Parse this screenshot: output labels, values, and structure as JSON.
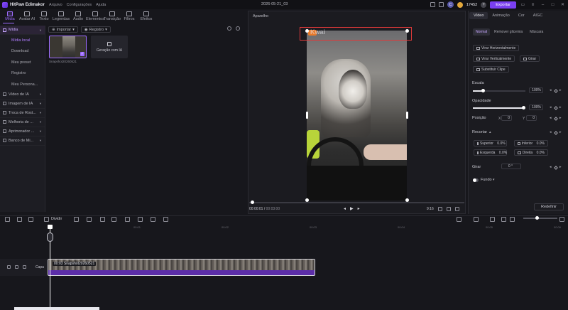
{
  "app": {
    "name": "HitPaw Edimakor",
    "menu": [
      "Arquivo",
      "Configurações",
      "Ajuda"
    ],
    "document_title": "2026-05-21_03",
    "credits": "17452",
    "avatar_letter": "C",
    "export_label": "Exportar"
  },
  "toolbar": [
    {
      "label": "Mídia",
      "active": true
    },
    {
      "label": "Avatar AI",
      "active": false
    },
    {
      "label": "Texto",
      "active": false
    },
    {
      "label": "Legendas",
      "active": false
    },
    {
      "label": "Áudio",
      "active": false
    },
    {
      "label": "Elementos",
      "active": false
    },
    {
      "label": "Transição",
      "active": false
    },
    {
      "label": "Filtros",
      "active": false
    },
    {
      "label": "Efeitos",
      "active": false
    }
  ],
  "leftnav": {
    "media": "Mídia",
    "sub": [
      "Mídia local",
      "Download",
      "Meu preset",
      "Registro",
      "Meu Persona..."
    ],
    "groups": [
      "Vídeo de IA",
      "Imagem de IA",
      "Troca de Rost...",
      "Melhoria de ...",
      "Aprimorador ...",
      "Banco de Mi..."
    ]
  },
  "media": {
    "import_label": "Importar",
    "record_label": "Registro",
    "thumb_name": "Snapshot20260521",
    "ai_card_label": "Geração com IA"
  },
  "preview": {
    "label": "Aparelho",
    "watermark": "Kwai",
    "current_time": "00:00:01",
    "total_time": "00:03:00",
    "aspect": "9:16"
  },
  "rpanel": {
    "tabs": [
      "Vídeo",
      "Animação",
      "Cor",
      "AIGC"
    ],
    "subtabs": [
      "Normal",
      "Remover glicemia",
      "Máscara"
    ],
    "flip_h": "Virar Horizontalmente",
    "flip_v": "Virar Verticalmente",
    "rotate_btn": "Girar",
    "replace_clip": "Substituir Clipe",
    "scale_label": "Escala",
    "scale_value": "100%",
    "opacity_label": "Opacidade",
    "opacity_value": "100%",
    "position_label": "Posição",
    "pos_x_label": "X",
    "pos_x": "0",
    "pos_y_label": "Y",
    "pos_y": "0",
    "crop_label": "Recortar",
    "crop_top_label": "Superior",
    "crop_top": "0.0%",
    "crop_bottom_label": "Inferior",
    "crop_bottom": "0.0%",
    "crop_left_label": "Esquerda",
    "crop_left": "0.0%",
    "crop_right_label": "Direita",
    "crop_right": "0.0%",
    "rotate_label": "Girar",
    "rotate_value": "0",
    "background_label": "Fundo",
    "reset_label": "Redefinir"
  },
  "timeline": {
    "split_label": "Dividir",
    "ruler": [
      "00:01",
      "00:02",
      "00:03",
      "00:04",
      "00:05",
      "00:06"
    ],
    "track_name": "Capa",
    "clip_label": "00:03 Snapshot20260521"
  }
}
